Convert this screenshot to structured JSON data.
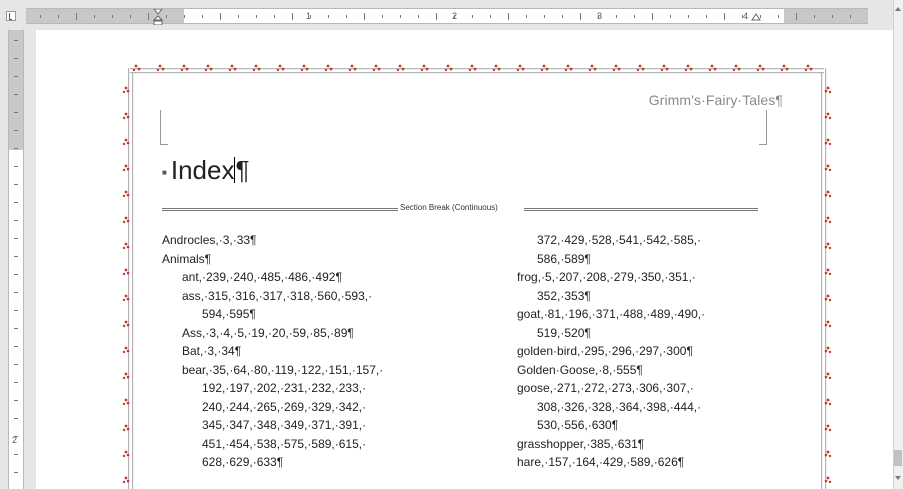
{
  "header": {
    "title": "Grimm's·Fairy·Tales¶"
  },
  "ruler": {
    "numbers": [
      "1",
      "2",
      "3",
      "4"
    ]
  },
  "vruler": {
    "numbers": [
      "2"
    ]
  },
  "index_heading": "Index¶",
  "section_break_label": "Section Break (Continuous)",
  "left_column": [
    {
      "text": "Androcles,·3,·33¶",
      "level": 0
    },
    {
      "text": "Animals¶",
      "level": 0
    },
    {
      "text": "ant,·239,·240,·485,·486,·492¶",
      "level": 1
    },
    {
      "text": "ass,·315,·316,·317,·318,·560,·593,·",
      "level": 1
    },
    {
      "text": "594,·595¶",
      "level": 2
    },
    {
      "text": "Ass,·3,·4,·5,·19,·20,·59,·85,·89¶",
      "level": 1
    },
    {
      "text": "Bat,·3,·34¶",
      "level": 1
    },
    {
      "text": "bear,·35,·64,·80,·119,·122,·151,·157,·",
      "level": 1
    },
    {
      "text": "192,·197,·202,·231,·232,·233,·",
      "level": 2
    },
    {
      "text": "240,·244,·265,·269,·329,·342,·",
      "level": 2
    },
    {
      "text": "345,·347,·348,·349,·371,·391,·",
      "level": 2
    },
    {
      "text": "451,·454,·538,·575,·589,·615,·",
      "level": 2
    },
    {
      "text": "628,·629,·633¶",
      "level": 2
    }
  ],
  "right_column": [
    {
      "text": "372,·429,·528,·541,·542,·585,·",
      "level": 1
    },
    {
      "text": "586,·589¶",
      "level": 1
    },
    {
      "text": "frog,·5,·207,·208,·279,·350,·351,·",
      "level": 0
    },
    {
      "text": "352,·353¶",
      "level": 1
    },
    {
      "text": "goat,·81,·196,·371,·488,·489,·490,·",
      "level": 0
    },
    {
      "text": "519,·520¶",
      "level": 1
    },
    {
      "text": "golden·bird,·295,·296,·297,·300¶",
      "level": 0
    },
    {
      "text": "Golden·Goose,·8,·555¶",
      "level": 0
    },
    {
      "text": "goose,·271,·272,·273,·306,·307,·",
      "level": 0
    },
    {
      "text": "308,·326,·328,·364,·398,·444,·",
      "level": 1
    },
    {
      "text": "530,·556,·630¶",
      "level": 1
    },
    {
      "text": "grasshopper,·385,·631¶",
      "level": 0
    },
    {
      "text": "hare,·157,·164,·429,·589,·626¶",
      "level": 0
    }
  ],
  "colors": {
    "border_dot_red": "#c0392b",
    "border_dot_grey": "#b5b5b5",
    "header_text": "#8a8a8a"
  }
}
